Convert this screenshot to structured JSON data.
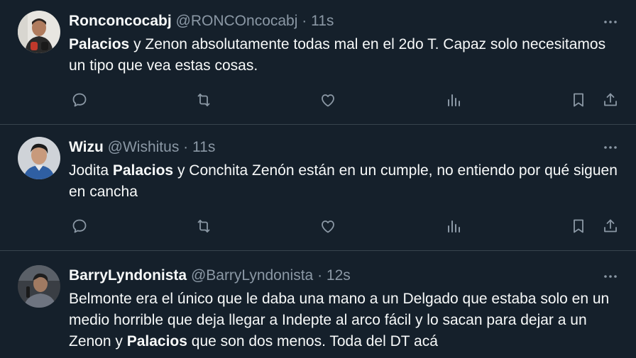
{
  "tweets": [
    {
      "name": "Ronconcocabj",
      "handle": "@RONCOncocabj",
      "dot": "·",
      "time": "11s",
      "text_parts": [
        {
          "bold": true,
          "text": "Palacios"
        },
        {
          "bold": false,
          "text": " y Zenon absolutamente todas mal en el 2do T. Capaz solo necesitamos un tipo que vea estas cosas."
        }
      ]
    },
    {
      "name": "Wizu",
      "handle": "@Wishitus",
      "dot": "·",
      "time": "11s",
      "text_parts": [
        {
          "bold": false,
          "text": "Jodita "
        },
        {
          "bold": true,
          "text": "Palacios"
        },
        {
          "bold": false,
          "text": " y Conchita Zenón están en un cumple, no entiendo por qué siguen en cancha"
        }
      ]
    },
    {
      "name": "BarryLyndonista",
      "handle": "@BarryLyndonista",
      "dot": "·",
      "time": "12s",
      "text_parts": [
        {
          "bold": false,
          "text": "Belmonte era el único que le daba una mano a un Delgado que estaba solo en un medio horrible que deja llegar a Indepte al arco fácil y lo sacan para dejar a un Zenon y "
        },
        {
          "bold": true,
          "text": "Palacios"
        },
        {
          "bold": false,
          "text": " que son dos menos. Toda del DT acá"
        }
      ]
    }
  ],
  "icons": {
    "more": "more-icon",
    "reply": "reply-icon",
    "retweet": "retweet-icon",
    "like": "heart-icon",
    "views": "views-icon",
    "bookmark": "bookmark-icon",
    "share": "share-icon"
  },
  "colors": {
    "background": "#15202b",
    "text": "#f7f9f9",
    "secondary": "#8b98a5",
    "divider": "#38444d"
  }
}
